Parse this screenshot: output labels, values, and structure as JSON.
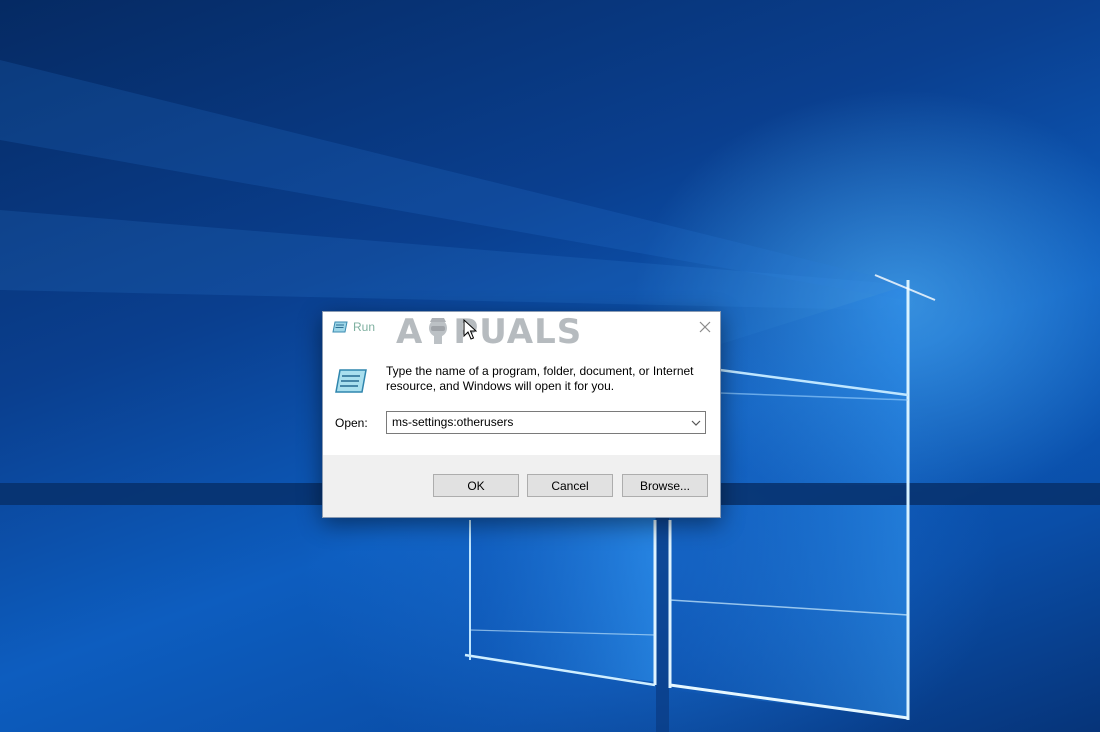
{
  "dialog": {
    "title": "Run",
    "instruction": "Type the name of a program, folder, document, or Internet resource, and Windows will open it for you.",
    "open_label": "Open:",
    "open_value": "ms-settings:otherusers",
    "buttons": {
      "ok": "OK",
      "cancel": "Cancel",
      "browse": "Browse..."
    }
  },
  "watermark": {
    "text_left": "A",
    "text_right": "PUALS"
  },
  "icons": [
    "run-icon",
    "close-icon",
    "chevron-down-icon",
    "mouse-pointer-icon"
  ],
  "colors": {
    "desktop_blue": "#0d5dbf",
    "button_face": "#e1e1e1",
    "footer_bg": "#f0f0f0"
  }
}
